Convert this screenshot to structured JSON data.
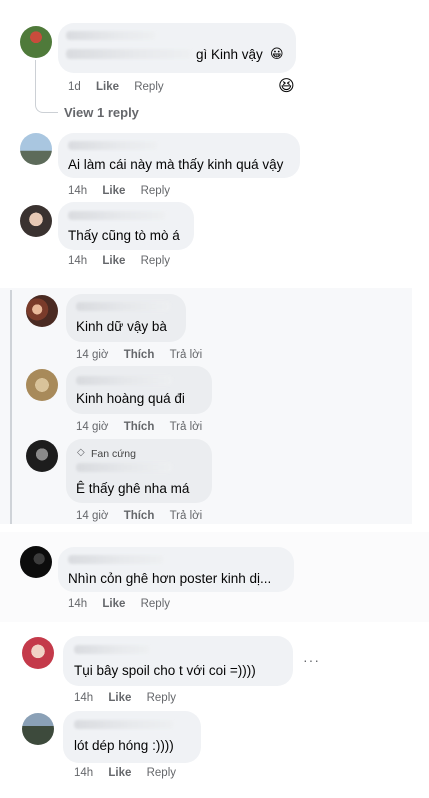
{
  "comments": [
    {
      "text": "gì Kinh vậy",
      "time": "1d",
      "like": "Like",
      "reply": "Reply",
      "emoji": "😀",
      "reaction": "😆"
    },
    {
      "text": "Ai làm cái này mà thấy kinh quá vậy",
      "time": "14h",
      "like": "Like",
      "reply": "Reply"
    },
    {
      "text": "Thấy cũng tò mò á",
      "time": "14h",
      "like": "Like",
      "reply": "Reply"
    },
    {
      "text": "Nhìn cỏn ghê hơn poster kinh dị...",
      "time": "14h",
      "like": "Like",
      "reply": "Reply"
    },
    {
      "text": "Tụi bây spoil cho t với coi =))))",
      "time": "14h",
      "like": "Like",
      "reply": "Reply",
      "more": "···"
    },
    {
      "text": "lót dép hóng :))))",
      "time": "14h",
      "like": "Like",
      "reply": "Reply"
    }
  ],
  "view_replies": "View 1 reply",
  "replies": [
    {
      "text": "Kinh dữ vậy bà",
      "time": "14 giờ",
      "like": "Thích",
      "reply": "Trả lời"
    },
    {
      "text": "Kinh hoàng quá đi",
      "time": "14 giờ",
      "like": "Thích",
      "reply": "Trả lời"
    },
    {
      "badge": "Fan cứng",
      "text": "Ê thấy ghê nha má",
      "time": "14 giờ",
      "like": "Thích",
      "reply": "Trả lời"
    }
  ]
}
